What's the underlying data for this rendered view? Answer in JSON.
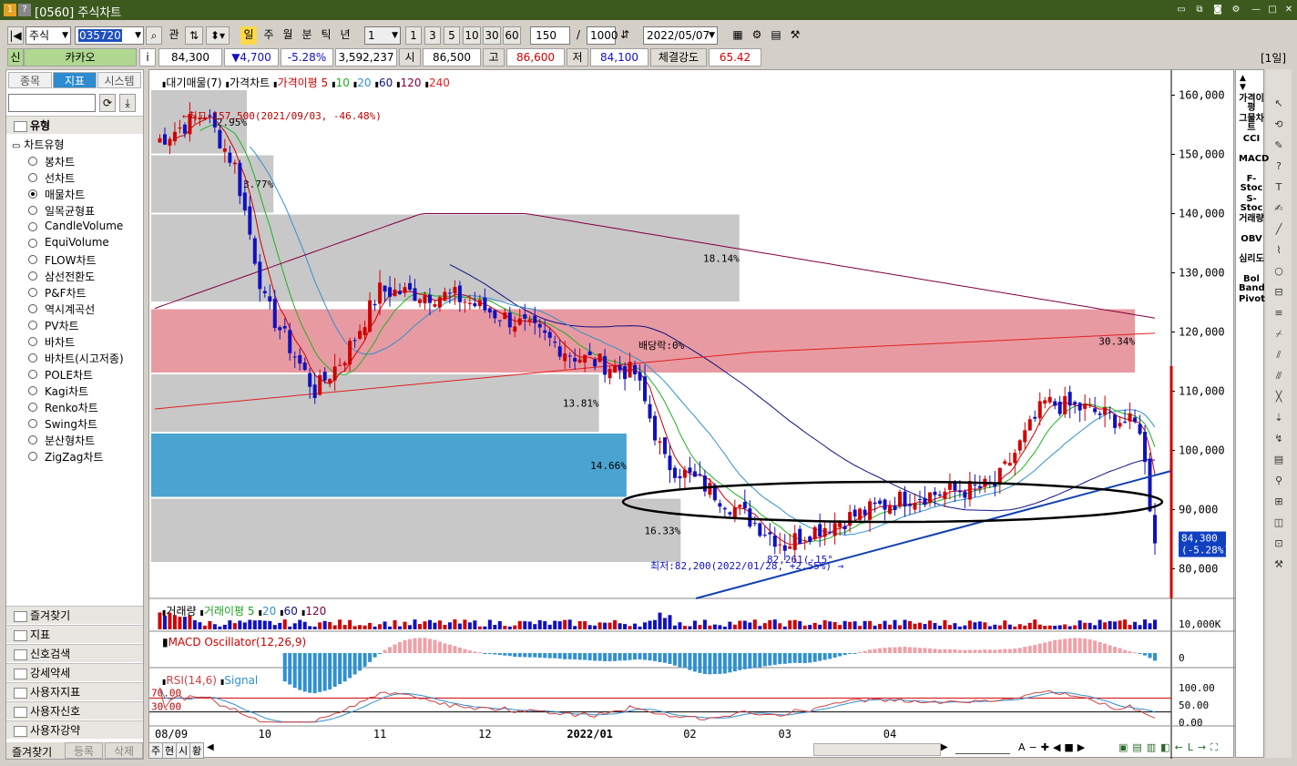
{
  "window": {
    "title": "[0560] 주식차트",
    "icons": [
      "1-icon",
      "help-icon"
    ]
  },
  "toolbar": {
    "market": "주식",
    "code": "035720",
    "gwan": "관",
    "periods": [
      "일",
      "주",
      "월",
      "분",
      "틱",
      "년"
    ],
    "period_selected": "일",
    "interval": "1",
    "quick_intervals": [
      "1",
      "3",
      "5",
      "10",
      "30",
      "60"
    ],
    "count": "150",
    "total": "1000",
    "date": "2022/05/07"
  },
  "quote": {
    "sin": "신",
    "name": "카카오",
    "info": "i",
    "price": "84,300",
    "change": "▼4,700",
    "rate": "-5.28%",
    "volume": "3,592,237",
    "open_label": "시",
    "open": "86,500",
    "high_label": "고",
    "high": "86,600",
    "low_label": "저",
    "low": "84,100",
    "strength_label": "체결강도",
    "strength": "65.42",
    "period_badge": "[1일]"
  },
  "left": {
    "tabs": [
      "종목",
      "지표",
      "시스템"
    ],
    "active_tab": "지표",
    "section": "유형",
    "chart_type_header": "차트유형",
    "chart_types": [
      {
        "label": "봉차트",
        "on": false
      },
      {
        "label": "선차트",
        "on": false
      },
      {
        "label": "매물차트",
        "on": true
      },
      {
        "label": "일목균형표",
        "on": false
      },
      {
        "label": "CandleVolume",
        "on": false
      },
      {
        "label": "EquiVolume",
        "on": false
      },
      {
        "label": "FLOW차트",
        "on": false
      },
      {
        "label": "삼선전환도",
        "on": false
      },
      {
        "label": "P&F차트",
        "on": false
      },
      {
        "label": "역시계곡선",
        "on": false
      },
      {
        "label": "PV차트",
        "on": false
      },
      {
        "label": "바차트",
        "on": false
      },
      {
        "label": "바차트(시고저종)",
        "on": false
      },
      {
        "label": "POLE차트",
        "on": false
      },
      {
        "label": "Kagi차트",
        "on": false
      },
      {
        "label": "Renko차트",
        "on": false
      },
      {
        "label": "Swing차트",
        "on": false
      },
      {
        "label": "분산형차트",
        "on": false
      },
      {
        "label": "ZigZag차트",
        "on": false
      }
    ],
    "sections": [
      "즐겨찾기",
      "지표",
      "신호검색",
      "강세약세",
      "사용자지표",
      "사용자신호",
      "사용자강약"
    ],
    "footer": [
      "즐겨찾기",
      "등록",
      "삭제"
    ]
  },
  "chart": {
    "legend": {
      "parts": [
        {
          "t": "대기매물(7)",
          "c": "#000000"
        },
        {
          "t": "가격차트",
          "c": "#000000"
        },
        {
          "t": "가격이평 5",
          "c": "#d00000"
        },
        {
          "t": "10",
          "c": "#20b020"
        },
        {
          "t": "20",
          "c": "#3090d0"
        },
        {
          "t": "60",
          "c": "#101080"
        },
        {
          "t": "120",
          "c": "#800040"
        },
        {
          "t": "240",
          "c": "#e02020"
        }
      ]
    },
    "annotations": {
      "max": "←최고:157,500(2021/09/03, -46.48%)",
      "min": "최저:82,200(2022/01/28, +2.55%) →",
      "div": "배당락:0%",
      "angle": "82,261(-15°"
    },
    "profile_labels": [
      "2.95%",
      "3.77%",
      "18.14%",
      "30.34%",
      "13.81%",
      "14.66%",
      "16.33%"
    ],
    "price_ticks": [
      "160,000",
      "150,000",
      "140,000",
      "130,000",
      "120,000",
      "110,000",
      "100,000",
      "90,000",
      "80,000"
    ],
    "current_label": [
      "84,300",
      "(-5.28%)"
    ],
    "x_labels": [
      "08/09",
      "10",
      "11",
      "12",
      "2022/01",
      "02",
      "03",
      "04"
    ],
    "vol_legend": [
      {
        "t": "거래량",
        "c": "#000000"
      },
      {
        "t": "거래이평 5",
        "c": "#20a020"
      },
      {
        "t": "20",
        "c": "#3090d0"
      },
      {
        "t": "60",
        "c": "#101080"
      },
      {
        "t": "120",
        "c": "#800040"
      }
    ],
    "vol_axis": "10,000K",
    "macd_legend": "MACD Oscillator(12,26,9)",
    "macd_axis": "0",
    "rsi_legend": [
      {
        "t": "RSI(14,6)",
        "c": "#d04040"
      },
      {
        "t": "Signal",
        "c": "#3090d0"
      }
    ],
    "rsi_levels": [
      "70.00",
      "30.00"
    ],
    "rsi_ticks": [
      "100.00",
      "50.00",
      "0.00"
    ]
  },
  "chart_data": {
    "type": "candlestick",
    "title": "",
    "x": [
      "2021-08",
      "2021-09",
      "2021-10",
      "2021-11",
      "2021-12",
      "2022-01",
      "2022-02",
      "2022-03",
      "2022-04"
    ],
    "close_approx": [
      152000,
      135000,
      117000,
      127000,
      120000,
      95000,
      88000,
      106000,
      84300
    ],
    "y_range": [
      75000,
      163000
    ]
  },
  "right_indicators": [
    "가격이평",
    "그물차트",
    "CCI",
    "MACD",
    "F-Stoc",
    "S-Stoc",
    "거래량",
    "OBV",
    "심리도",
    "Bol Band",
    "Pivot"
  ],
  "bottom": {
    "tabs": [
      "주",
      "현",
      "시",
      "황"
    ]
  },
  "colors": {
    "up": "#d00000",
    "down": "#1010c0",
    "profile_grey": "#c8c8c8",
    "profile_pink": "#e89aa2",
    "profile_blue": "#4aa3d0",
    "title": "#3d5a1e"
  }
}
